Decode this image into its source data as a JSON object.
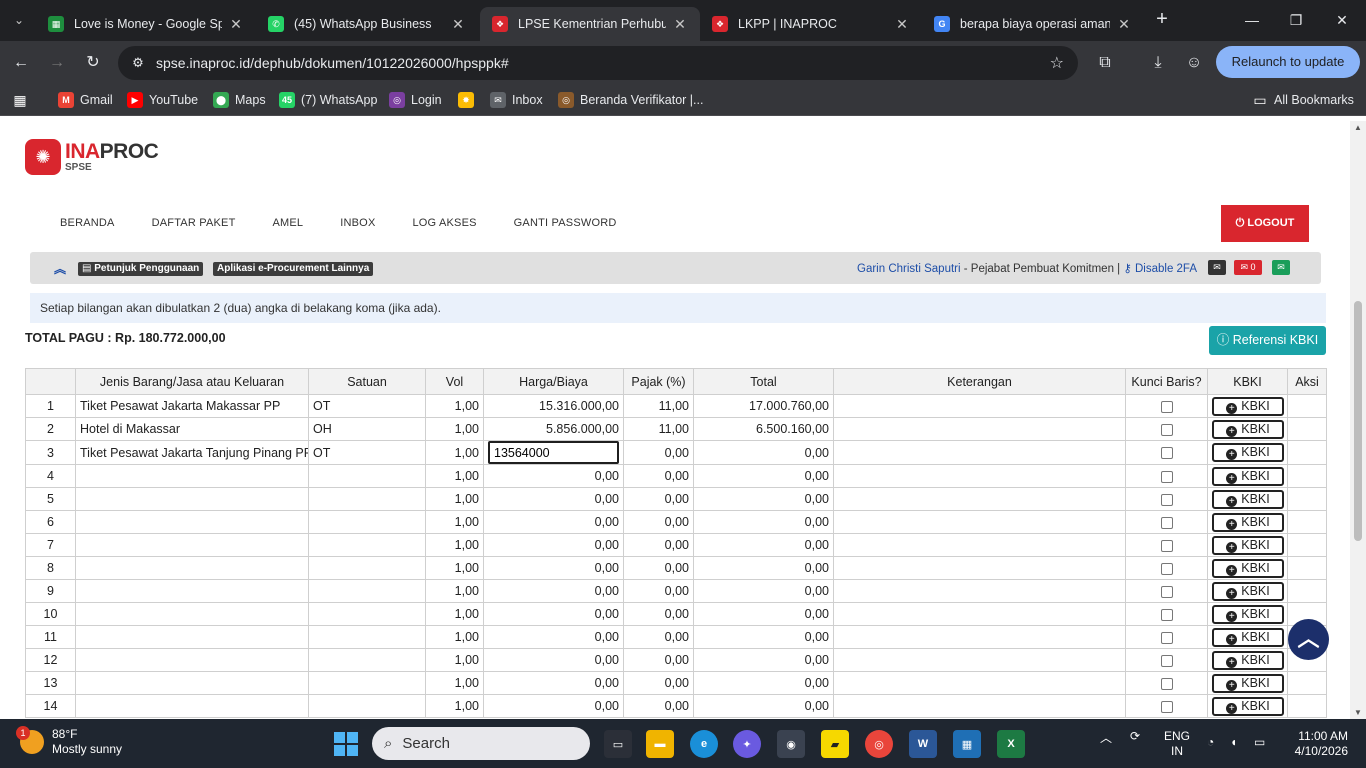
{
  "browser": {
    "tabs": [
      {
        "title": "Love is Money - Google Spre",
        "icon": "google-sheets-icon",
        "color": "#1e8e3e",
        "glyph": "▦"
      },
      {
        "title": "(45) WhatsApp Business",
        "icon": "whatsapp-icon",
        "color": "#25d366",
        "glyph": "✆"
      },
      {
        "title": "LPSE Kementrian Perhubung",
        "icon": "inaproc-icon",
        "color": "#d9262e",
        "glyph": "❖"
      },
      {
        "title": "LKPP | INAPROC",
        "icon": "inaproc-icon",
        "color": "#d9262e",
        "glyph": "❖"
      },
      {
        "title": "berapa biaya operasi amand",
        "icon": "google-icon",
        "color": "#4285f4",
        "glyph": "G"
      }
    ],
    "url": "spse.inaproc.id/dephub/dokumen/10122026000/hpsppk#",
    "relaunch_label": "Relaunch to update",
    "bookmarks": [
      {
        "label": "Gmail",
        "icon": "gmail-icon",
        "color": "#ea4335",
        "glyph": "M"
      },
      {
        "label": "YouTube",
        "icon": "youtube-icon",
        "color": "#ff0000",
        "glyph": "▶"
      },
      {
        "label": "Maps",
        "icon": "maps-icon",
        "color": "#34a853",
        "glyph": "⬤"
      },
      {
        "label": "(7) WhatsApp",
        "icon": "whatsapp-icon",
        "color": "#25d366",
        "glyph": "45"
      },
      {
        "label": "Login",
        "icon": "login-icon",
        "color": "#7b3fa0",
        "glyph": "◎"
      },
      {
        "label": "",
        "icon": "photos-icon",
        "color": "#fbbc04",
        "glyph": "✸"
      },
      {
        "label": "Inbox",
        "icon": "inbox-icon",
        "color": "#5f6368",
        "glyph": "✉"
      },
      {
        "label": "Beranda Verifikator |...",
        "icon": "verifikator-icon",
        "color": "#8a5a2b",
        "glyph": "◎"
      }
    ],
    "all_bookmarks_label": "All Bookmarks"
  },
  "header": {
    "logo_text_1": "INA",
    "logo_text_2": "PROC",
    "logo_sub": "SPSE",
    "nav": [
      "BERANDA",
      "DAFTAR PAKET",
      "AMEL",
      "INBOX",
      "LOG AKSES",
      "GANTI PASSWORD"
    ],
    "logout_label": "LOGOUT"
  },
  "infobar": {
    "help_label": "Petunjuk Penggunaan",
    "other_apps_label": "Aplikasi e-Procurement Lainnya",
    "user_name": "Garin Christi Saputri",
    "user_role": " - Pejabat Pembuat Komitmen | ",
    "disable_2fa": "Disable 2FA",
    "mail_count": "0"
  },
  "notice": "Setiap bilangan akan dibulatkan 2 (dua) angka di belakang koma (jika ada).",
  "total_pagu": "TOTAL PAGU : Rp. 180.772.000,00",
  "referensi_label": "Referensi KBKI",
  "table": {
    "headers": [
      "",
      "Jenis Barang/Jasa atau Keluaran",
      "Satuan",
      "Vol",
      "Harga/Biaya",
      "Pajak (%)",
      "Total",
      "Keterangan",
      "Kunci Baris?",
      "KBKI",
      "Aksi"
    ],
    "kbki_label": "KBKI",
    "editing_value": "13564000",
    "rows": [
      {
        "no": "1",
        "jenis": "Tiket Pesawat Jakarta Makassar PP",
        "satuan": "OT",
        "vol": "1,00",
        "harga": "15.316.000,00",
        "pajak": "11,00",
        "total": "17.000.760,00"
      },
      {
        "no": "2",
        "jenis": "Hotel di Makassar",
        "satuan": "OH",
        "vol": "1,00",
        "harga": "5.856.000,00",
        "pajak": "11,00",
        "total": "6.500.160,00"
      },
      {
        "no": "3",
        "jenis": "Tiket Pesawat Jakarta Tanjung Pinang PP",
        "satuan": "OT",
        "vol": "1,00",
        "harga": "",
        "pajak": "0,00",
        "total": "0,00",
        "editing": true
      },
      {
        "no": "4",
        "jenis": "",
        "satuan": "",
        "vol": "1,00",
        "harga": "0,00",
        "pajak": "0,00",
        "total": "0,00"
      },
      {
        "no": "5",
        "jenis": "",
        "satuan": "",
        "vol": "1,00",
        "harga": "0,00",
        "pajak": "0,00",
        "total": "0,00"
      },
      {
        "no": "6",
        "jenis": "",
        "satuan": "",
        "vol": "1,00",
        "harga": "0,00",
        "pajak": "0,00",
        "total": "0,00"
      },
      {
        "no": "7",
        "jenis": "",
        "satuan": "",
        "vol": "1,00",
        "harga": "0,00",
        "pajak": "0,00",
        "total": "0,00"
      },
      {
        "no": "8",
        "jenis": "",
        "satuan": "",
        "vol": "1,00",
        "harga": "0,00",
        "pajak": "0,00",
        "total": "0,00"
      },
      {
        "no": "9",
        "jenis": "",
        "satuan": "",
        "vol": "1,00",
        "harga": "0,00",
        "pajak": "0,00",
        "total": "0,00"
      },
      {
        "no": "10",
        "jenis": "",
        "satuan": "",
        "vol": "1,00",
        "harga": "0,00",
        "pajak": "0,00",
        "total": "0,00"
      },
      {
        "no": "11",
        "jenis": "",
        "satuan": "",
        "vol": "1,00",
        "harga": "0,00",
        "pajak": "0,00",
        "total": "0,00"
      },
      {
        "no": "12",
        "jenis": "",
        "satuan": "",
        "vol": "1,00",
        "harga": "0,00",
        "pajak": "0,00",
        "total": "0,00"
      },
      {
        "no": "13",
        "jenis": "",
        "satuan": "",
        "vol": "1,00",
        "harga": "0,00",
        "pajak": "0,00",
        "total": "0,00"
      },
      {
        "no": "14",
        "jenis": "",
        "satuan": "",
        "vol": "1,00",
        "harga": "0,00",
        "pajak": "0,00",
        "total": "0,00"
      }
    ]
  },
  "taskbar": {
    "weather_temp": "88°F",
    "weather_desc": "Mostly sunny",
    "weather_badge": "1",
    "search_label": "Search",
    "lang_1": "ENG",
    "lang_2": "IN",
    "time": "11:00 AM",
    "date": "4/10/2026"
  },
  "colors": {
    "brand_red": "#d9262e",
    "teal_button": "#1aa3a8",
    "link_blue": "#1e4ea8"
  }
}
